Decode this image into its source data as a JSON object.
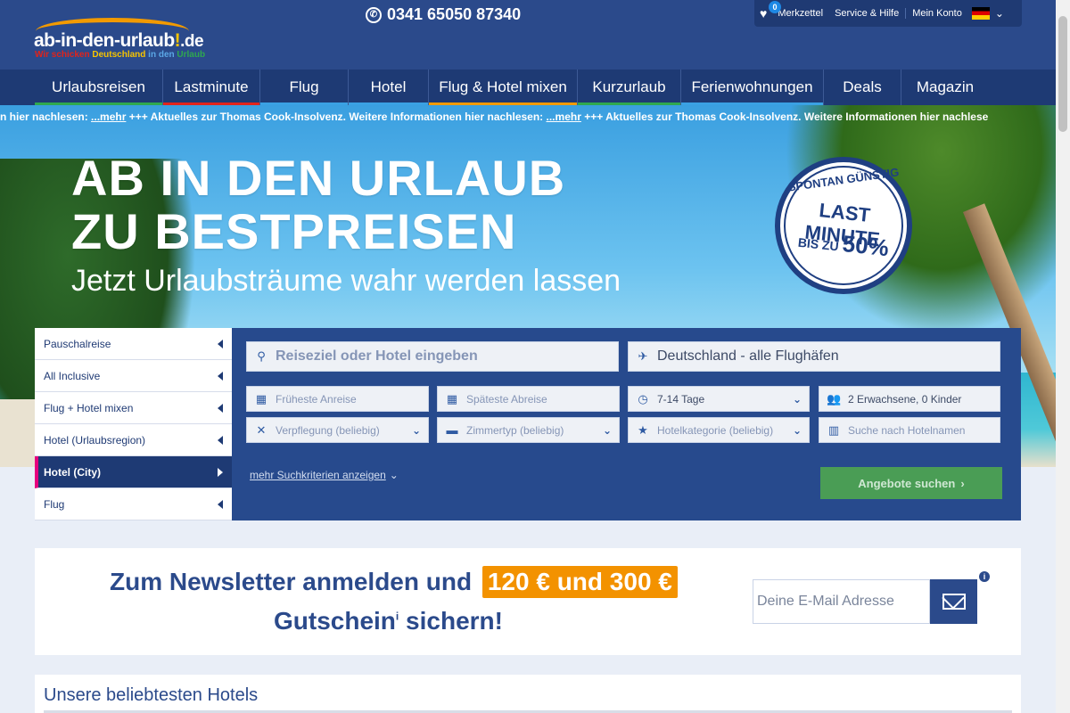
{
  "logo": {
    "main": "ab-in-den-urlaub",
    "bang": "!",
    "de": ".de",
    "tag_1": "Wir schicken ",
    "tag_2": "Deutschland",
    "tag_3": " in den ",
    "tag_4": "Urlaub"
  },
  "phone": {
    "icon": "phone-icon",
    "number": "0341 65050 87340"
  },
  "topbar": {
    "watchlist_count": "0",
    "watchlist_label": "Merkzettel",
    "service": "Service & Hilfe",
    "account": "Mein Konto"
  },
  "nav": [
    {
      "label": "Urlaubsreisen",
      "color": "#2fa84f"
    },
    {
      "label": "Lastminute",
      "color": "#e2231a"
    },
    {
      "label": "Flug",
      "color": "#3aa1e3"
    },
    {
      "label": "Hotel",
      "color": "#3aa1e3"
    },
    {
      "label": "Flug & Hotel mixen",
      "color": "#f29a00"
    },
    {
      "label": "Kurzurlaub",
      "color": "#2fa84f"
    },
    {
      "label": "Ferienwohnungen",
      "color": "#3aa1e3"
    },
    {
      "label": "Deals",
      "color": "#1e3a74"
    },
    {
      "label": "Magazin",
      "color": "#1e3a74"
    }
  ],
  "ticker": {
    "lead": "n hier nachlesen: ",
    "link": "...mehr",
    "text": " +++ Aktuelles zur Thomas Cook-Insolvenz. Weitere Informationen hier nachlesen: ",
    "link2": "...mehr",
    "tail": " +++ Aktuelles zur Thomas Cook-Insolvenz. Weitere Informationen hier nachlese"
  },
  "hero": {
    "line1": "AB IN DEN URLAUB",
    "line2": "ZU BESTPREISEN",
    "subline": "Jetzt Urlaubsträume wahr werden lassen"
  },
  "stamp": {
    "top": "SPONTAN GÜNSTIG",
    "mid": "LAST MINUTE",
    "bot_prefix": "BIS ZU ",
    "bot_value": "50%"
  },
  "sidebar": [
    {
      "label": "Pauschalreise"
    },
    {
      "label": "All Inclusive"
    },
    {
      "label": "Flug + Hotel mixen"
    },
    {
      "label": "Hotel (Urlaubsregion)"
    },
    {
      "label": "Hotel (City)",
      "active": true
    },
    {
      "label": "Flug"
    }
  ],
  "search": {
    "destination_placeholder": "Reiseziel oder Hotel eingeben",
    "airports": "Deutschland - alle Flughäfen",
    "earliest": "Früheste Anreise",
    "latest": "Späteste Abreise",
    "duration": "7-14 Tage",
    "travellers": "2 Erwachsene, 0 Kinder",
    "board": "Verpflegung (beliebig)",
    "room": "Zimmertyp (beliebig)",
    "category": "Hotelkategorie (beliebig)",
    "hotelname_placeholder": "Suche nach Hotelnamen",
    "more": "mehr Suchkriterien anzeigen",
    "submit": "Angebote suchen"
  },
  "newsletter": {
    "title_part1": "Zum Newsletter anmelden und",
    "highlight": "120 € und 300 €",
    "title_part2": "Gutschein",
    "sup": "i",
    "title_part3": " sichern!",
    "placeholder": "Deine E-Mail Adresse",
    "info": "i"
  },
  "hotels": {
    "title": "Unsere beliebtesten Hotels"
  }
}
